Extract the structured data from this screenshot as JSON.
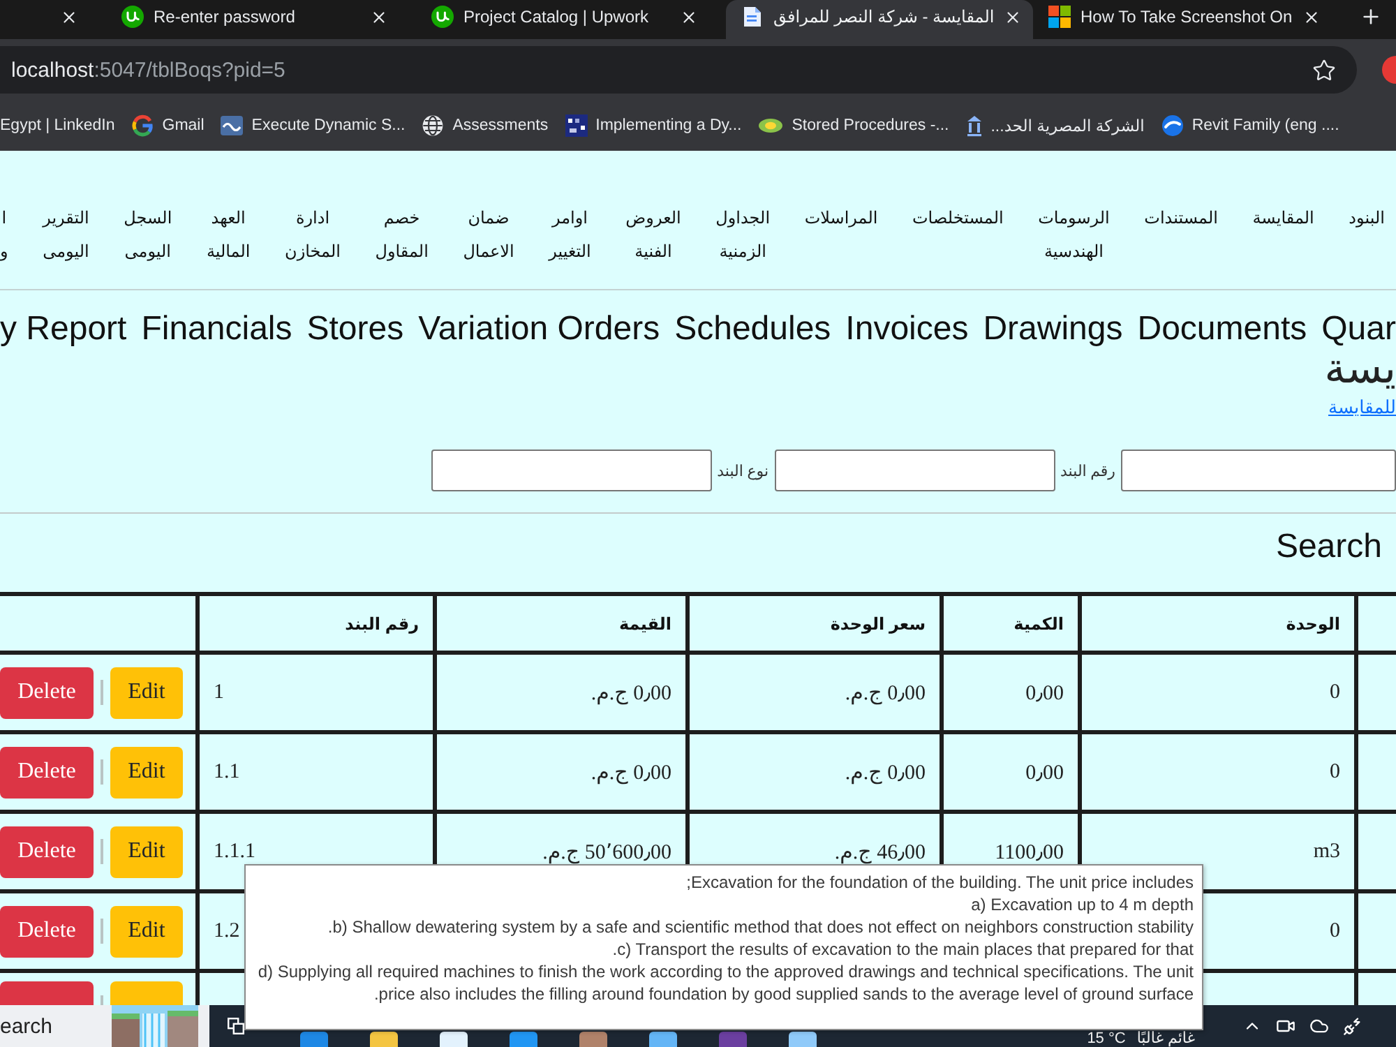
{
  "browser": {
    "tabs": [
      {
        "kind": "squares",
        "title": "How To Take Screenshot On",
        "selected": false
      },
      {
        "kind": "document",
        "title": "المقايسة - شركة النصر للمرافق",
        "selected": true
      },
      {
        "kind": "logo",
        "title": "Project Catalog | Upwork",
        "selected": false
      },
      {
        "kind": "logo",
        "title": "Re-enter password",
        "selected": false
      },
      {
        "kind": "blank",
        "selected": false
      }
    ],
    "address": {
      "host": "localhost",
      "rest": ":5047/tblBoqs?pid=5"
    },
    "bookmarks": [
      {
        "kind": "swoosh",
        "label": "Revit Family (eng ...."
      },
      {
        "kind": "building",
        "label": "الشركة المصرية الحد..."
      },
      {
        "kind": "bug",
        "label": "Stored Procedures -..."
      },
      {
        "kind": "pixel",
        "label": "Implementing a Dy..."
      },
      {
        "kind": "globe",
        "label": "Assessments"
      },
      {
        "kind": "sql",
        "label": "Execute Dynamic S..."
      },
      {
        "kind": "g",
        "label": "Gmail"
      },
      {
        "label": "Egypt | LinkedIn"
      }
    ]
  },
  "page": {
    "menu": [
      "البنود",
      "المقايسة",
      "المستندات",
      "الرسومات الهندسية",
      "المستخلصات",
      "المراسلات",
      "الجداول الزمنية",
      "العروض الفنية",
      "اوامر التغيير",
      "ضمان الاعمال",
      "خصم المقاول",
      "ادارة المخازن",
      "العهد المالية",
      "السجل اليومى",
      "التقرير اليومى",
      "ا و"
    ],
    "menu_en": [
      "Quar",
      "Documents",
      "Drawings",
      "Invoices",
      "Schedules",
      "Variation Orders",
      "Stores",
      "Financials",
      "y Report"
    ],
    "heading": "يسة",
    "add_link": "للمقايسة",
    "filters": [
      {
        "kind": "input"
      },
      {
        "kind": "label",
        "text": "رقم البند"
      },
      {
        "kind": "input"
      },
      {
        "kind": "label",
        "text": "نوع البند"
      },
      {
        "kind": "input"
      }
    ],
    "search_button": "Search",
    "table": {
      "columns": [
        "الوحدة",
        "الكمية",
        "سعر الوحدة",
        "القيمة",
        "رقم البند"
      ],
      "rows": [
        {
          "unit": "0",
          "quantity": "0٫00",
          "unit_price": "0٫00 ج.م.",
          "value": "0٫00 ج.م.",
          "item_no": "1",
          "actions": [
            {
              "kind": "edit",
              "label": "Edit"
            },
            {
              "kind": "delete",
              "label": "Delete"
            }
          ]
        },
        {
          "unit": "0",
          "quantity": "0٫00",
          "unit_price": "0٫00 ج.م.",
          "value": "0٫00 ج.م.",
          "item_no": "1.1",
          "actions": [
            {
              "kind": "edit",
              "label": "Edit"
            },
            {
              "kind": "delete",
              "label": "Delete"
            }
          ]
        },
        {
          "unit": "m3",
          "quantity": "1100٫00",
          "unit_price": "46٫00 ج.م.",
          "value": "50٬600٫00 ج.م.",
          "item_no": "1.1.1",
          "actions": [
            {
              "kind": "edit",
              "label": "Edit"
            },
            {
              "kind": "delete",
              "label": "Delete"
            }
          ]
        },
        {
          "unit": "0",
          "item_no": "1.2",
          "actions": [
            {
              "kind": "edit",
              "label": "Edit"
            },
            {
              "kind": "delete",
              "label": "Delete"
            }
          ]
        },
        {
          "actions": [
            {
              "kind": "edit"
            },
            {
              "kind": "delete"
            }
          ]
        }
      ]
    }
  },
  "tooltip": {
    "lines": [
      ";Excavation for the foundation of the building. The unit price includes",
      "a) Excavation up to 4 m depth",
      ".b) Shallow dewatering system by a safe and scientific method that does not effect on neighbors construction stability",
      ".c) Transport the results of excavation to the main places that prepared for that",
      "d) Supplying all required machines to finish the work according to the approved drawings and technical specifications. The unit",
      ".price also includes the filling around foundation by good supplied sands to the average level of ground surface"
    ]
  },
  "taskbar": {
    "search_text": "earch",
    "weather_temp": "15 °C",
    "weather_text": "غائم غالبًا"
  }
}
